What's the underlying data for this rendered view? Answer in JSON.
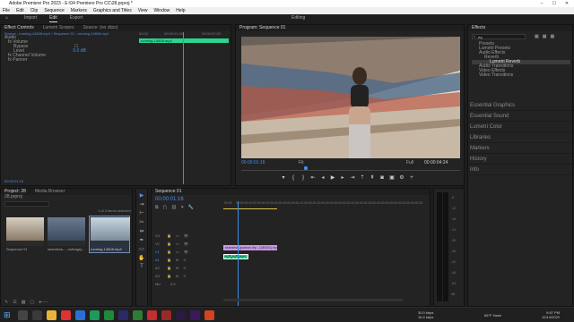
{
  "app": {
    "title": "Adobe Premiere Pro 2023 - E:\\04 Premiere Pro CC\\28.prproj *"
  },
  "menu": [
    "File",
    "Edit",
    "Clip",
    "Sequence",
    "Markers",
    "Graphics and Titles",
    "View",
    "Window",
    "Help"
  ],
  "workspace": {
    "tabs": [
      "Import",
      "Edit",
      "Export"
    ],
    "active": "Edit",
    "center": "Editing"
  },
  "source_panel": {
    "tabs": [
      "Effect Controls",
      "Lumetri Scopes",
      "Source: (no clips)"
    ],
    "clip_path": "Source - running-14608.mp4 › Sequence 01 - running-14608.mp4",
    "section": "Audio",
    "rows": [
      {
        "label": "Volume"
      },
      {
        "label": "Bypass",
        "value": "☐"
      },
      {
        "label": "Level",
        "value": "0.0 dB"
      },
      {
        "label": "Channel Volume"
      },
      {
        "label": "Panner"
      }
    ],
    "clip_label": "running-14608.mp4",
    "time_start": "00:00",
    "time_mid": "00:00:01:00",
    "time_end": "00:00:02:00",
    "timecode": "00:00:01:16"
  },
  "program": {
    "title": "Program: Sequence 01",
    "timecode": "00:00:01:16",
    "fit": "Fit",
    "quality": "Full",
    "duration": "00:00:04:24"
  },
  "project": {
    "tabs": [
      "Project: 28",
      "Media Browser"
    ],
    "file": "28.prproj",
    "selection": "1 of 3 items selected",
    "items": [
      {
        "name": "Sequence 01",
        "duration": "3;00"
      },
      {
        "name": "seamless-...-nstbags(...",
        "duration": "10:00"
      },
      {
        "name": "running-14608.mp4",
        "duration": "0:00:04"
      }
    ]
  },
  "timeline": {
    "tab": "Sequence 01",
    "timecode": "00:00:01:16",
    "ruler": [
      ":00:00",
      "00:00:00:10",
      "00:00:00:20",
      "00:00:01:00",
      "00:00:01:10",
      "00:00:01:20",
      "00:00:02:00",
      "00:00:02:10",
      "00:00:02:20",
      "00:00:03:00",
      "00:00:03:10",
      "00:00:03:20"
    ],
    "tracks": [
      "V3",
      "V2",
      "V1",
      "A1",
      "A2",
      "A3",
      "Mix"
    ],
    "clip_v1": "seamless-gucecon-fhp...(180401).mp4 [V]",
    "clip_a1": "",
    "mix_value": "0.0"
  },
  "effects": {
    "title": "Effects",
    "search": "eq",
    "tree": [
      "Presets",
      "Lumetri Presets",
      "Audio Effects",
      "Reverb",
      "Lumetri Reverb",
      "Audio Transitions",
      "Video Effects",
      "Video Transitions"
    ],
    "sections": [
      "Essential Graphics",
      "Essential Sound",
      "Lumetri Color",
      "Libraries",
      "Markers",
      "History",
      "Info"
    ]
  },
  "meter": {
    "labels": [
      "-6",
      "-12",
      "-18",
      "-24",
      "-30",
      "-36",
      "-42",
      "-48",
      "-54",
      "dB"
    ]
  },
  "taskbar": {
    "net_up": "30.0 kbps",
    "net_down": "16.4 kbps",
    "weather": "66°F Haze",
    "time": "9:57 PM",
    "date": "12/14/2022"
  },
  "colors": {
    "accent": "#4a90e2",
    "clip_green": "#2bd48f",
    "clip_pink": "#c79be0",
    "playhead": "#3a8ee6"
  }
}
